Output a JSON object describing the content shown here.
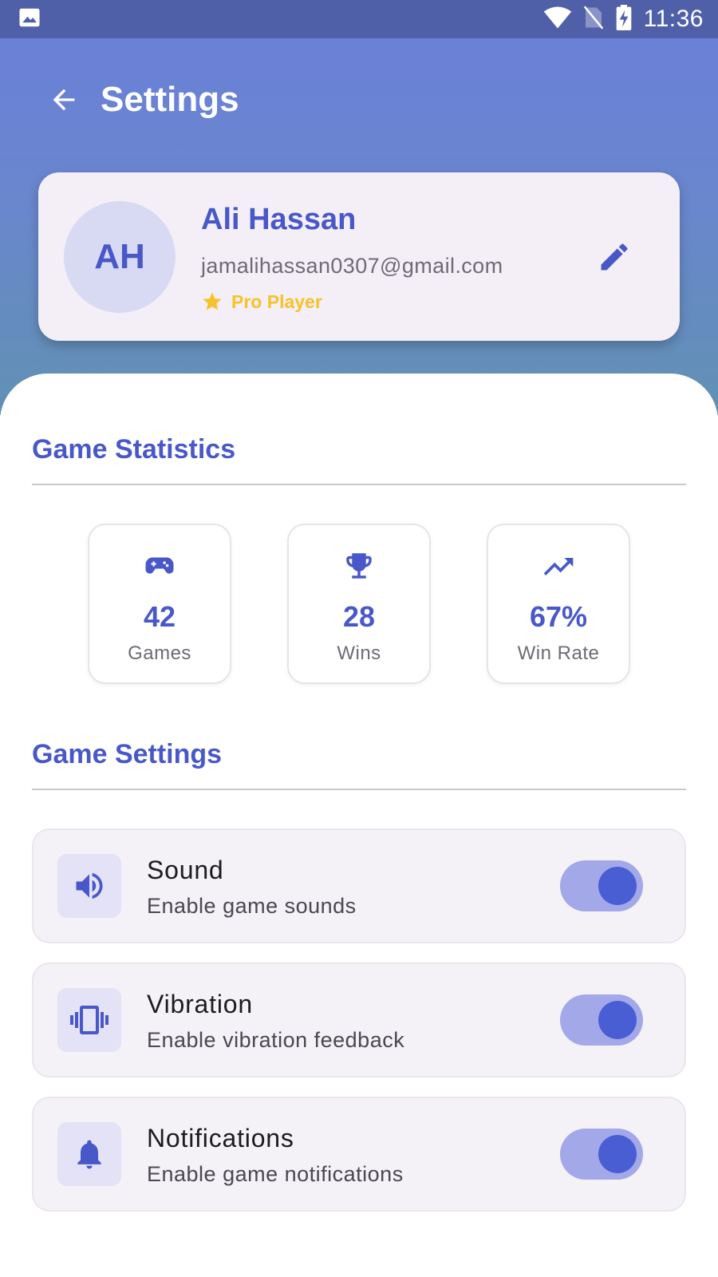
{
  "status_bar": {
    "time": "11:36"
  },
  "app_bar": {
    "title": "Settings"
  },
  "profile": {
    "initials": "AH",
    "name": "Ali Hassan",
    "email": "jamalihassan0307@gmail.com",
    "badge": "Pro Player"
  },
  "stats_section": {
    "title": "Game Statistics",
    "items": [
      {
        "value": "42",
        "label": "Games",
        "icon": "gamepad-icon"
      },
      {
        "value": "28",
        "label": "Wins",
        "icon": "trophy-icon"
      },
      {
        "value": "67%",
        "label": "Win Rate",
        "icon": "trending-up-icon"
      }
    ]
  },
  "settings_section": {
    "title": "Game Settings",
    "items": [
      {
        "title": "Sound",
        "subtitle": "Enable game sounds",
        "icon": "volume-icon",
        "enabled": true
      },
      {
        "title": "Vibration",
        "subtitle": "Enable vibration feedback",
        "icon": "vibration-icon",
        "enabled": true
      },
      {
        "title": "Notifications",
        "subtitle": "Enable game notifications",
        "icon": "bell-icon",
        "enabled": true
      }
    ]
  },
  "colors": {
    "primary": "#4858c8",
    "badge": "#f7c22a",
    "toggle_track": "#a2a8e8",
    "toggle_knob": "#4a5ed4"
  }
}
